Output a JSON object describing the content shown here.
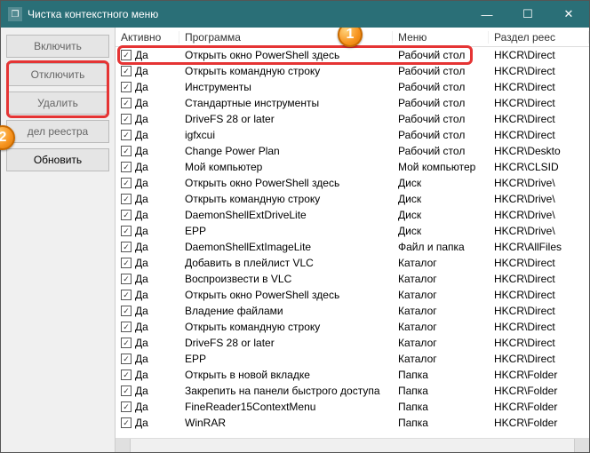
{
  "window": {
    "title": "Чистка контекстного меню"
  },
  "sidebar": {
    "buttons": [
      {
        "label": "Включить"
      },
      {
        "label": "Отключить"
      },
      {
        "label": "Удалить"
      },
      {
        "label": "дел реестра"
      },
      {
        "label": "Обновить"
      }
    ]
  },
  "columns": {
    "active": "Активно",
    "program": "Программа",
    "menu": "Меню",
    "registry": "Раздел реес"
  },
  "active_label": "Да",
  "rows": [
    {
      "program": "Открыть окно PowerShell здесь",
      "menu": "Рабочий стол",
      "reg": "HKCR\\Direct"
    },
    {
      "program": "Открыть командную строку",
      "menu": "Рабочий стол",
      "reg": "HKCR\\Direct"
    },
    {
      "program": "Инструменты",
      "menu": "Рабочий стол",
      "reg": "HKCR\\Direct"
    },
    {
      "program": "Стандартные инструменты",
      "menu": "Рабочий стол",
      "reg": "HKCR\\Direct"
    },
    {
      "program": "DriveFS 28 or later",
      "menu": "Рабочий стол",
      "reg": "HKCR\\Direct"
    },
    {
      "program": "igfxcui",
      "menu": "Рабочий стол",
      "reg": "HKCR\\Direct"
    },
    {
      "program": "Change Power Plan",
      "menu": "Рабочий стол",
      "reg": "HKCR\\Deskto"
    },
    {
      "program": "Мой компьютер",
      "menu": "Мой компьютер",
      "reg": "HKCR\\CLSID"
    },
    {
      "program": "Открыть окно PowerShell здесь",
      "menu": "Диск",
      "reg": "HKCR\\Drive\\"
    },
    {
      "program": "Открыть командную строку",
      "menu": "Диск",
      "reg": "HKCR\\Drive\\"
    },
    {
      "program": "DaemonShellExtDriveLite",
      "menu": "Диск",
      "reg": "HKCR\\Drive\\"
    },
    {
      "program": "EPP",
      "menu": "Диск",
      "reg": "HKCR\\Drive\\"
    },
    {
      "program": "DaemonShellExtImageLite",
      "menu": "Файл и папка",
      "reg": "HKCR\\AllFiles"
    },
    {
      "program": "Добавить в плейлист VLC",
      "menu": "Каталог",
      "reg": "HKCR\\Direct"
    },
    {
      "program": "Воспроизвести в VLC",
      "menu": "Каталог",
      "reg": "HKCR\\Direct"
    },
    {
      "program": "Открыть окно PowerShell здесь",
      "menu": "Каталог",
      "reg": "HKCR\\Direct"
    },
    {
      "program": "Владение файлами",
      "menu": "Каталог",
      "reg": "HKCR\\Direct"
    },
    {
      "program": "Открыть командную строку",
      "menu": "Каталог",
      "reg": "HKCR\\Direct"
    },
    {
      "program": "DriveFS 28 or later",
      "menu": "Каталог",
      "reg": "HKCR\\Direct"
    },
    {
      "program": "EPP",
      "menu": "Каталог",
      "reg": "HKCR\\Direct"
    },
    {
      "program": "Открыть в новой вкладке",
      "menu": "Папка",
      "reg": "HKCR\\Folder"
    },
    {
      "program": "Закрепить на панели быстрого доступа",
      "menu": "Папка",
      "reg": "HKCR\\Folder"
    },
    {
      "program": "FineReader15ContextMenu",
      "menu": "Папка",
      "reg": "HKCR\\Folder"
    },
    {
      "program": "WinRAR",
      "menu": "Папка",
      "reg": "HKCR\\Folder"
    }
  ],
  "callouts": {
    "one": "1",
    "two": "2"
  }
}
